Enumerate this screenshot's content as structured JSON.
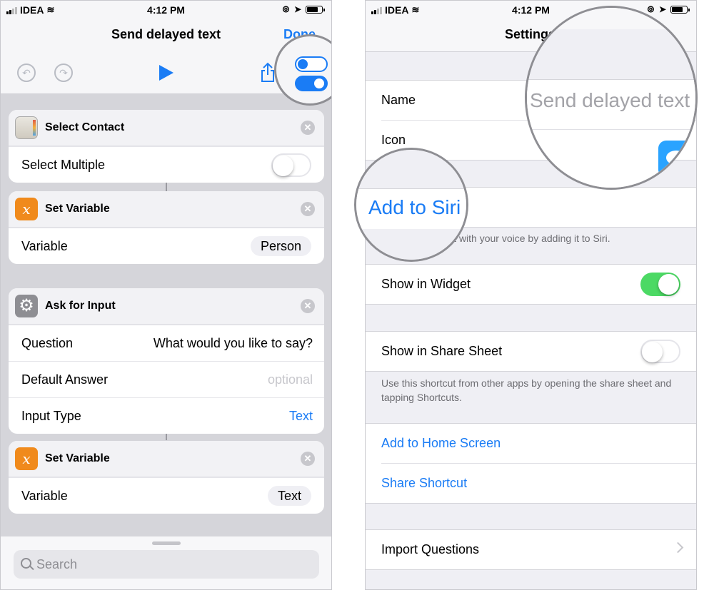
{
  "left": {
    "status": {
      "carrier": "IDEA",
      "time": "4:12 PM"
    },
    "header": {
      "title": "Send delayed text",
      "done": "Done"
    },
    "actions": [
      {
        "title": "Select Contact",
        "rows": [
          {
            "label": "Select Multiple",
            "toggle": false
          }
        ]
      },
      {
        "title": "Set Variable",
        "rows": [
          {
            "label": "Variable",
            "value": "Person"
          }
        ]
      },
      {
        "title": "Ask for Input",
        "rows": [
          {
            "label": "Question",
            "value": "What would you like to say?"
          },
          {
            "label": "Default Answer",
            "value": "optional"
          },
          {
            "label": "Input Type",
            "value": "Text"
          }
        ]
      },
      {
        "title": "Set Variable",
        "rows": [
          {
            "label": "Variable",
            "value": "Text"
          }
        ]
      }
    ],
    "search": {
      "placeholder": "Search"
    }
  },
  "right": {
    "status": {
      "carrier": "IDEA",
      "time": "4:12 PM"
    },
    "header": {
      "title": "Settings"
    },
    "name_row": {
      "label": "Name",
      "value": "Send delayed text"
    },
    "icon_row": {
      "label": "Icon"
    },
    "add_to_siri": {
      "label": "Add to Siri",
      "footer": "Run this shortcut with your voice by adding it to Siri."
    },
    "widget": {
      "label": "Show in Widget",
      "toggle": true
    },
    "share_sheet": {
      "label": "Show in Share Sheet",
      "toggle": false,
      "footer": "Use this shortcut from other apps by opening the share sheet and tapping Shortcuts."
    },
    "links": {
      "home_screen": "Add to Home Screen",
      "share": "Share Shortcut"
    },
    "import": {
      "label": "Import Questions"
    }
  },
  "colors": {
    "accent": "#1a7cf5",
    "switch_on": "#4cd964",
    "variable_icon": "#f08a1c"
  }
}
